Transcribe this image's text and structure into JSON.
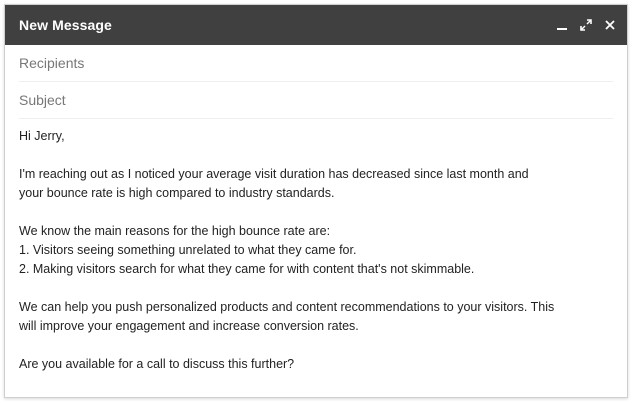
{
  "window": {
    "title": "New Message",
    "controls": {
      "minimize_icon": "minimize-icon",
      "expand_icon": "expand-icon",
      "close_icon": "close-icon"
    },
    "titlebar_color": "#404040"
  },
  "fields": {
    "recipients_placeholder": "Recipients",
    "subject_placeholder": "Subject"
  },
  "message": {
    "greeting": "Hi Jerry,",
    "para1_line1": "I'm reaching out as I noticed your average visit duration has decreased since last month and",
    "para1_line2": "your bounce rate is high compared to industry standards.",
    "para2_line1": "We know the main reasons for the high bounce rate are:",
    "para2_line2": "1. Visitors seeing something unrelated to what they came for.",
    "para2_line3": "2. Making visitors search for what they came for with content that's not skimmable.",
    "para3_line1": "We can help you push personalized products and content recommendations to your visitors. This",
    "para3_line2": "will improve your engagement and increase conversion rates.",
    "closing": "Are you available for a call to discuss this further?"
  }
}
